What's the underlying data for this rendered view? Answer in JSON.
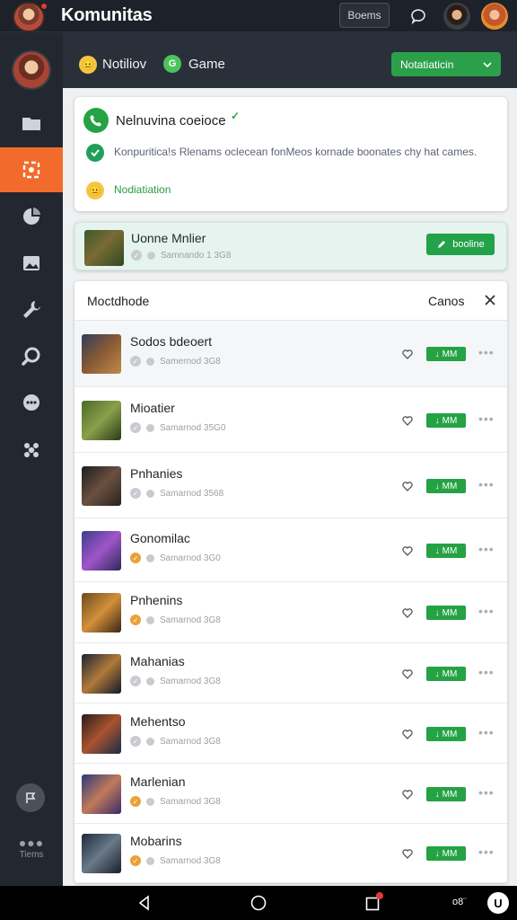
{
  "app": {
    "title": "Komunitas",
    "top_button": "Boems"
  },
  "sidebar": {
    "more_label": "Tiems"
  },
  "header": {
    "label_1": "Notiliov",
    "label_2": "Game",
    "badge": "G",
    "action_button": "Notatiaticin"
  },
  "notice": {
    "title": "Nelnuvina coeioce",
    "body": "Konpuritica!s Rlenams oclecean fonMeos kornade boonates chy hat cames.",
    "link": "Nodiatiation"
  },
  "featured": {
    "name": "Uonne Mnlier",
    "meta": "Samnando 1 3G8",
    "button": "booline"
  },
  "list": {
    "title": "Moctdhode",
    "cancel": "Canos",
    "rows": [
      {
        "name": "Sodos bdeoert",
        "meta": "Samernod 3G8",
        "tag": "MM"
      },
      {
        "name": "Mioatier",
        "meta": "Samarnod 35G0",
        "tag": "MM"
      },
      {
        "name": "Pnhanies",
        "meta": "Samarnod 3568",
        "tag": "MM"
      },
      {
        "name": "Gonomilac",
        "meta": "Samarnod 3G0",
        "tag": "MM"
      },
      {
        "name": "Pnhenins",
        "meta": "Samarnod 3G8",
        "tag": "MM"
      },
      {
        "name": "Mahanias",
        "meta": "Samarnod 3G8",
        "tag": "MM"
      },
      {
        "name": "Mehentso",
        "meta": "Samarnod 3G8",
        "tag": "MM"
      },
      {
        "name": "Marlenian",
        "meta": "Samarnod 3G8",
        "tag": "MM"
      },
      {
        "name": "Mobarins",
        "meta": "Samarnod 3G8",
        "tag": "MM"
      }
    ]
  },
  "system": {
    "nav_text": "o8¨"
  },
  "colors": {
    "accent_green": "#25a244",
    "sidebar_active": "#f26b2c",
    "header_bg": "#2a303a",
    "topbar_bg": "#1d222a"
  }
}
